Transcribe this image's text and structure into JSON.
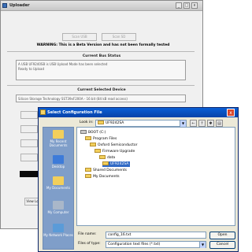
{
  "uploader": {
    "title": "Uploader",
    "minimize_glyph": "_",
    "maximize_glyph": "□",
    "close_glyph": "x",
    "buttons": [
      "Scan USB",
      "Scan SD"
    ],
    "warning": "WARNING: This is a Beta Version and has not been formally tested",
    "bus_status_title": "Current Bus Status",
    "bus_status_lines": [
      "A USB UF9240SB is USB Upload Mode has been selected",
      "Ready to Upload"
    ],
    "device_title": "Current Selected Device",
    "device_text": "Silicon Storage Technology SST39xF200A - 16 bit (84 kB read access)",
    "view_log_label": "View Lo"
  },
  "dialog": {
    "title": "Select Configuration File",
    "close_glyph": "x",
    "look_in_label": "Look in:",
    "look_in_value": "UF9242SA",
    "toolbar_icons": [
      "back-icon",
      "up-folder-icon",
      "new-folder-icon",
      "view-menu-icon"
    ],
    "places": [
      {
        "label": "My Recent Documents",
        "color": "#f2cf5b"
      },
      {
        "label": "Desktop",
        "color": "#3d7bd9"
      },
      {
        "label": "My Documents",
        "color": "#f2cf5b"
      },
      {
        "label": "My Computer",
        "color": "#a9b7c9"
      },
      {
        "label": "My Network Places",
        "color": "#5a9bd8"
      }
    ],
    "tree": [
      {
        "label": "BOOT (C:)"
      },
      {
        "label": "Program Files"
      },
      {
        "label": "Oxford Semiconductor"
      },
      {
        "label": "Firmware Upgrade"
      },
      {
        "label": "data"
      },
      {
        "label": "UF9242SA",
        "selected": true
      },
      {
        "label": "Shared Documents"
      },
      {
        "label": "My Documents"
      }
    ],
    "file_name_label": "File name:",
    "file_name_value": "config_16.txt",
    "file_type_label": "Files of type:",
    "file_type_value": "Configuration text files (*.txt)",
    "open_label": "Open",
    "cancel_label": "Cancel"
  }
}
